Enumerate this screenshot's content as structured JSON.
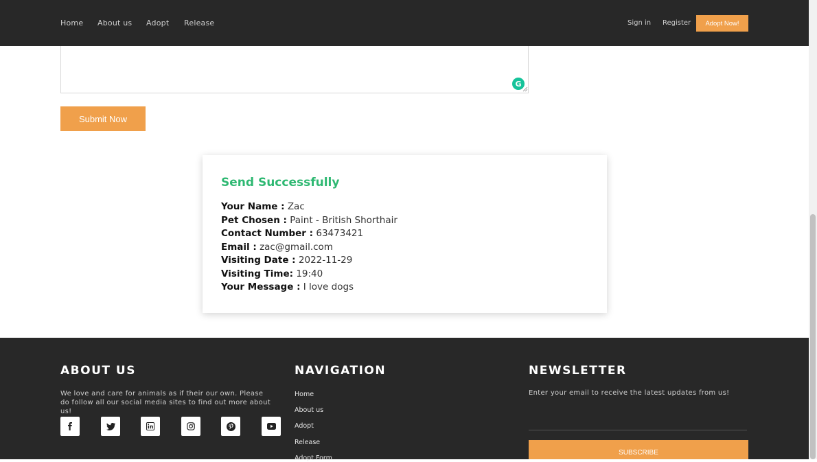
{
  "navbar": {
    "links": [
      "Home",
      "About us",
      "Adopt",
      "Release"
    ],
    "sign_in": "Sign in",
    "register": "Register",
    "adopt_now": "Adopt Now!"
  },
  "form": {
    "grammarly_icon": "G",
    "submit_label": "Submit Now"
  },
  "success": {
    "title": "Send Successfully",
    "rows": [
      {
        "label": "Your Name :",
        "value": "Zac"
      },
      {
        "label": "Pet Chosen :",
        "value": "Paint - British Shorthair"
      },
      {
        "label": "Contact Number :",
        "value": "63473421"
      },
      {
        "label": "Email :",
        "value": "zac@gmail.com"
      },
      {
        "label": "Visiting Date :",
        "value": "2022-11-29"
      },
      {
        "label": "Visiting Time:",
        "value": "19:40"
      },
      {
        "label": "Your Message :",
        "value": "I love dogs"
      }
    ]
  },
  "footer": {
    "about": {
      "heading": "ABOUT US",
      "text": "We love and care for animals as if their our own. Please do follow all our social media sites to find out more about us!",
      "socials": [
        "facebook-icon",
        "twitter-icon",
        "linkedin-icon",
        "instagram-icon",
        "pinterest-icon",
        "youtube-icon"
      ]
    },
    "navigation": {
      "heading": "NAVIGATION",
      "items": [
        "Home",
        "About us",
        "Adopt",
        "Release",
        "Adopt Form"
      ]
    },
    "newsletter": {
      "heading": "NEWSLETTER",
      "text": "Enter your email to receive the latest updates from us!",
      "email_value": "",
      "subscribe_label": "SUBSCRIBE"
    }
  },
  "colors": {
    "accent": "#f0a04b",
    "success": "#2eb872",
    "dark": "#282828"
  }
}
